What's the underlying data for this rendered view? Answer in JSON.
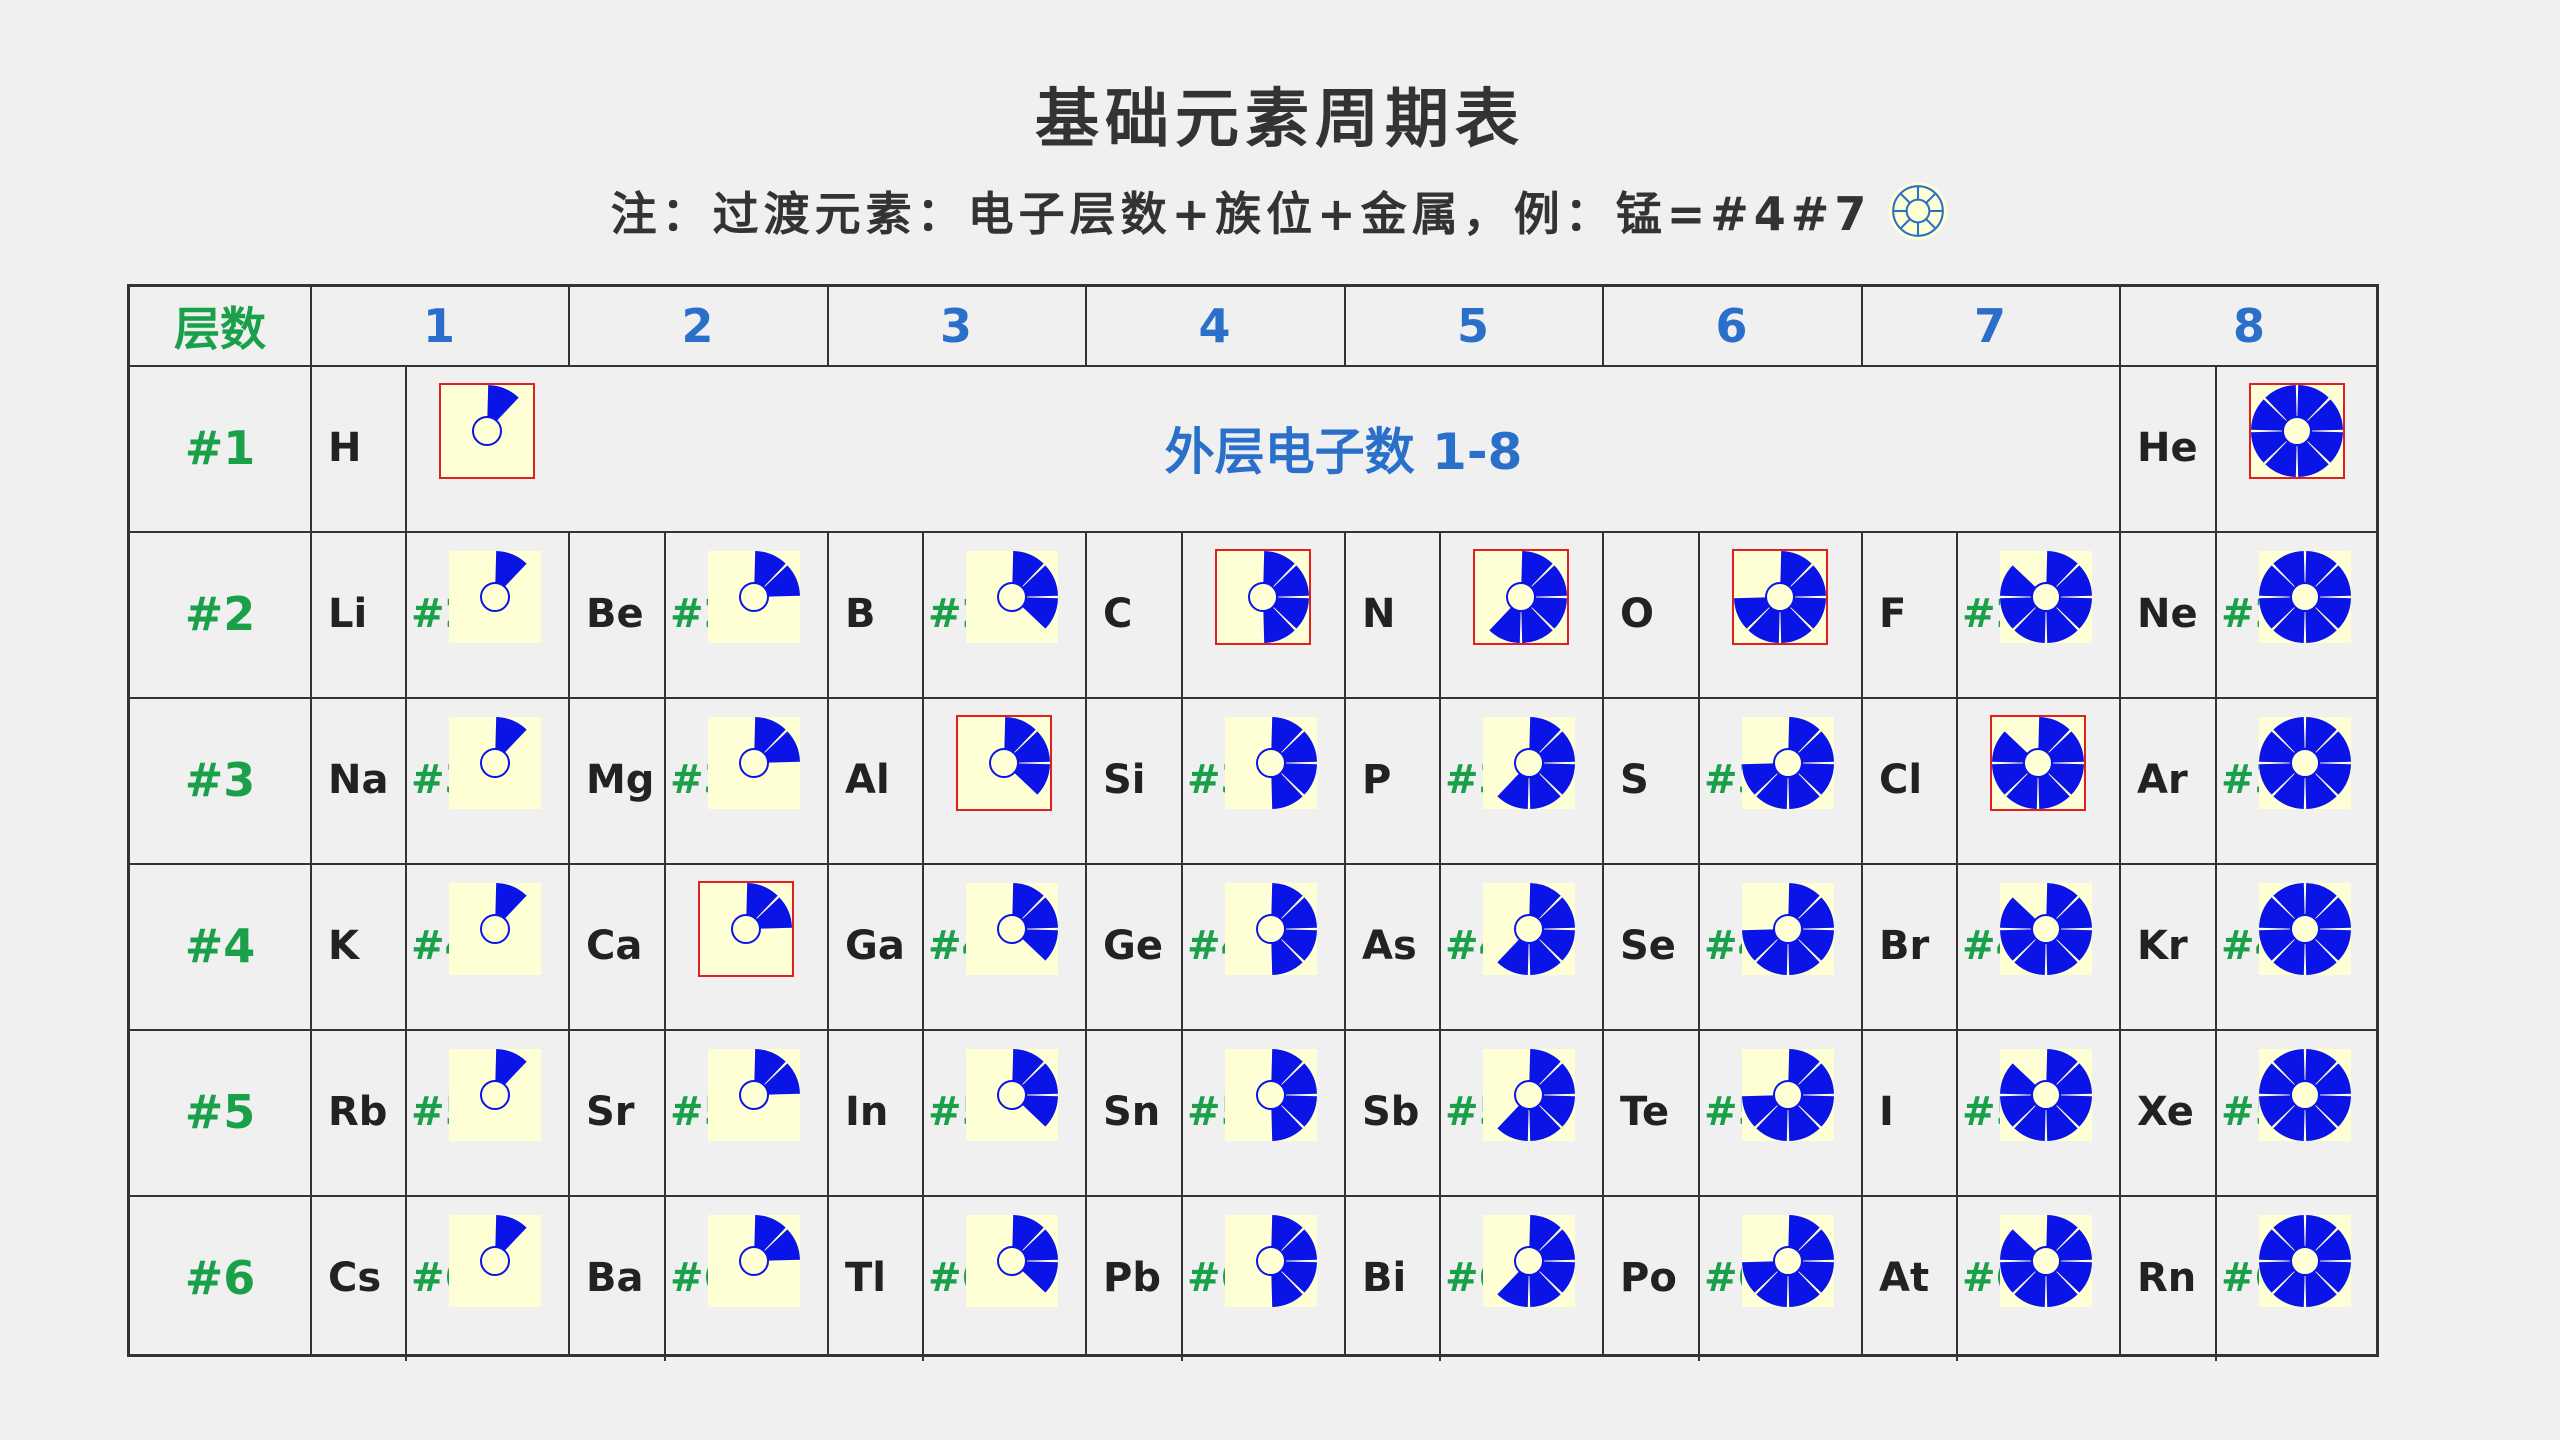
{
  "title": "基础元素周期表",
  "note": "注：过渡元素：电子层数+族位+金属，例：锰=#4#7",
  "header": {
    "layer_label": "层数",
    "groups": [
      "1",
      "2",
      "3",
      "4",
      "5",
      "6",
      "7",
      "8"
    ]
  },
  "banner": "外层电子数 1-8",
  "colors": {
    "layer_green": "#1aa049",
    "group_blue": "#2a6fc9",
    "electron_blue": "#0a14e6",
    "icon_bg": "#ffffd6",
    "highlight_red": "#e02020"
  },
  "rows": [
    {
      "label": "#1",
      "cells": [
        {
          "symbol": "H",
          "prefix": "",
          "electrons": 1,
          "highlight": true
        },
        null,
        null,
        null,
        null,
        null,
        null,
        {
          "symbol": "He",
          "prefix": "",
          "electrons": 8,
          "highlight": true
        }
      ]
    },
    {
      "label": "#2",
      "cells": [
        {
          "symbol": "Li",
          "prefix": "#2",
          "electrons": 1,
          "highlight": false
        },
        {
          "symbol": "Be",
          "prefix": "#2",
          "electrons": 2,
          "highlight": false
        },
        {
          "symbol": "B",
          "prefix": "#2",
          "electrons": 3,
          "highlight": false
        },
        {
          "symbol": "C",
          "prefix": "",
          "electrons": 4,
          "highlight": true
        },
        {
          "symbol": "N",
          "prefix": "",
          "electrons": 5,
          "highlight": true
        },
        {
          "symbol": "O",
          "prefix": "",
          "electrons": 6,
          "highlight": true
        },
        {
          "symbol": "F",
          "prefix": "#2",
          "electrons": 7,
          "highlight": false
        },
        {
          "symbol": "Ne",
          "prefix": "#2",
          "electrons": 8,
          "highlight": false
        }
      ]
    },
    {
      "label": "#3",
      "cells": [
        {
          "symbol": "Na",
          "prefix": "#3",
          "electrons": 1,
          "highlight": false
        },
        {
          "symbol": "Mg",
          "prefix": "#3",
          "electrons": 2,
          "highlight": false
        },
        {
          "symbol": "Al",
          "prefix": "",
          "electrons": 3,
          "highlight": true
        },
        {
          "symbol": "Si",
          "prefix": "#3",
          "electrons": 4,
          "highlight": false
        },
        {
          "symbol": "P",
          "prefix": "#3",
          "electrons": 5,
          "highlight": false
        },
        {
          "symbol": "S",
          "prefix": "#3",
          "electrons": 6,
          "highlight": false
        },
        {
          "symbol": "Cl",
          "prefix": "",
          "electrons": 7,
          "highlight": true
        },
        {
          "symbol": "Ar",
          "prefix": "#3",
          "electrons": 8,
          "highlight": false
        }
      ]
    },
    {
      "label": "#4",
      "cells": [
        {
          "symbol": "K",
          "prefix": "#4",
          "electrons": 1,
          "highlight": false
        },
        {
          "symbol": "Ca",
          "prefix": "",
          "electrons": 2,
          "highlight": true
        },
        {
          "symbol": "Ga",
          "prefix": "#4",
          "electrons": 3,
          "highlight": false
        },
        {
          "symbol": "Ge",
          "prefix": "#4",
          "electrons": 4,
          "highlight": false
        },
        {
          "symbol": "As",
          "prefix": "#4",
          "electrons": 5,
          "highlight": false
        },
        {
          "symbol": "Se",
          "prefix": "#4",
          "electrons": 6,
          "highlight": false
        },
        {
          "symbol": "Br",
          "prefix": "#4",
          "electrons": 7,
          "highlight": false
        },
        {
          "symbol": "Kr",
          "prefix": "#4",
          "electrons": 8,
          "highlight": false
        }
      ]
    },
    {
      "label": "#5",
      "cells": [
        {
          "symbol": "Rb",
          "prefix": "#5",
          "electrons": 1,
          "highlight": false
        },
        {
          "symbol": "Sr",
          "prefix": "#5",
          "electrons": 2,
          "highlight": false
        },
        {
          "symbol": "In",
          "prefix": "#5",
          "electrons": 3,
          "highlight": false
        },
        {
          "symbol": "Sn",
          "prefix": "#5",
          "electrons": 4,
          "highlight": false
        },
        {
          "symbol": "Sb",
          "prefix": "#5",
          "electrons": 5,
          "highlight": false
        },
        {
          "symbol": "Te",
          "prefix": "#5",
          "electrons": 6,
          "highlight": false
        },
        {
          "symbol": "I",
          "prefix": "#5",
          "electrons": 7,
          "highlight": false
        },
        {
          "symbol": "Xe",
          "prefix": "#5",
          "electrons": 8,
          "highlight": false
        }
      ]
    },
    {
      "label": "#6",
      "cells": [
        {
          "symbol": "Cs",
          "prefix": "#6",
          "electrons": 1,
          "highlight": false
        },
        {
          "symbol": "Ba",
          "prefix": "#6",
          "electrons": 2,
          "highlight": false
        },
        {
          "symbol": "Tl",
          "prefix": "#6",
          "electrons": 3,
          "highlight": false
        },
        {
          "symbol": "Pb",
          "prefix": "#6",
          "electrons": 4,
          "highlight": false
        },
        {
          "symbol": "Bi",
          "prefix": "#6",
          "electrons": 5,
          "highlight": false
        },
        {
          "symbol": "Po",
          "prefix": "#6",
          "electrons": 6,
          "highlight": false
        },
        {
          "symbol": "At",
          "prefix": "#6",
          "electrons": 7,
          "highlight": false
        },
        {
          "symbol": "Rn",
          "prefix": "#6",
          "electrons": 8,
          "highlight": false
        }
      ]
    }
  ]
}
